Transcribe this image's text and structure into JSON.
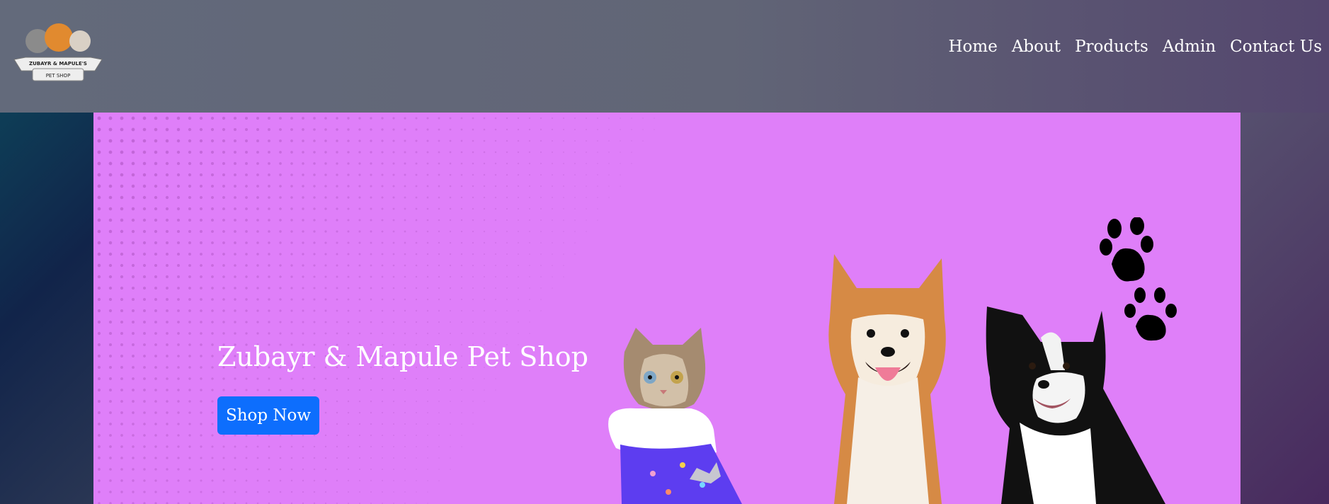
{
  "header": {
    "logo": {
      "line1": "ZUBAYR & MAPULE'S",
      "line2": "PET SHOP"
    },
    "nav": [
      {
        "label": "Home"
      },
      {
        "label": "About"
      },
      {
        "label": "Products"
      },
      {
        "label": "Admin"
      },
      {
        "label": "Contact Us"
      }
    ]
  },
  "hero": {
    "title": "Zubayr & Mapule Pet Shop",
    "cta_label": "Shop Now",
    "background_color": "#df7ff9",
    "button_color": "#0d6efd",
    "icons": [
      "cat-photo",
      "shiba-photo",
      "collie-photo",
      "paw-print-icon",
      "paw-print-icon"
    ]
  }
}
